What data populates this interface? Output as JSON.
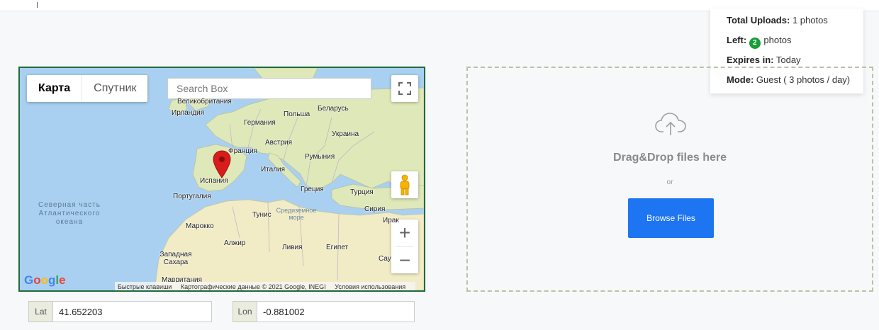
{
  "stats": {
    "total_label": "Total Uploads:",
    "total_value": "1 photos",
    "left_label": "Left:",
    "left_count": "2",
    "left_unit": "photos",
    "expires_label": "Expires in:",
    "expires_value": "Today",
    "mode_label": "Mode:",
    "mode_value": "Guest ( 3 photos / day)",
    "badge_color": "#1a9c3b"
  },
  "map": {
    "type_map": "Карта",
    "type_satellite": "Спутник",
    "search_placeholder": "Search Box",
    "labels": {
      "uk": "Великобритания",
      "ireland": "Ирландия",
      "poland": "Польша",
      "belarus": "Беларусь",
      "germany": "Германия",
      "ukraine": "Украина",
      "austria": "Австрия",
      "france": "Франция",
      "romania": "Румыния",
      "italy": "Италия",
      "spain": "Испания",
      "greece": "Греция",
      "turkey": "Турция",
      "portugal": "Португалия",
      "tunisia": "Тунис",
      "mediterranean": "Средиземное море",
      "syria": "Сирия",
      "iraq": "Ирак",
      "morocco": "Марокко",
      "algeria": "Алжир",
      "libya": "Ливия",
      "egypt": "Египет",
      "saudi": "Сау",
      "western_sahara": "Западная Сахара",
      "mauritania": "Мавритания",
      "atlantic": "Северная часть Атлантического океана"
    },
    "logo": "Google",
    "attribution": {
      "shortcuts": "Быстрые клавиши",
      "data": "Картографические данные © 2021 Google, INEGI",
      "terms": "Условия использования"
    },
    "zoom_in": "+",
    "zoom_out": "−",
    "colors": {
      "water": "#a9d0f0",
      "land": "#dfe8b8",
      "land_south": "#f2ecc6",
      "marker": "#d81c1c",
      "border": "#1f6b3a"
    }
  },
  "coords": {
    "lat_label": "Lat",
    "lat_value": "41.652203",
    "lon_label": "Lon",
    "lon_value": "-0.881002"
  },
  "upload": {
    "title": "Drag&Drop files here",
    "or": "or",
    "browse": "Browse Files",
    "button_color": "#1e75f2",
    "icon": "cloud-upload-icon"
  }
}
